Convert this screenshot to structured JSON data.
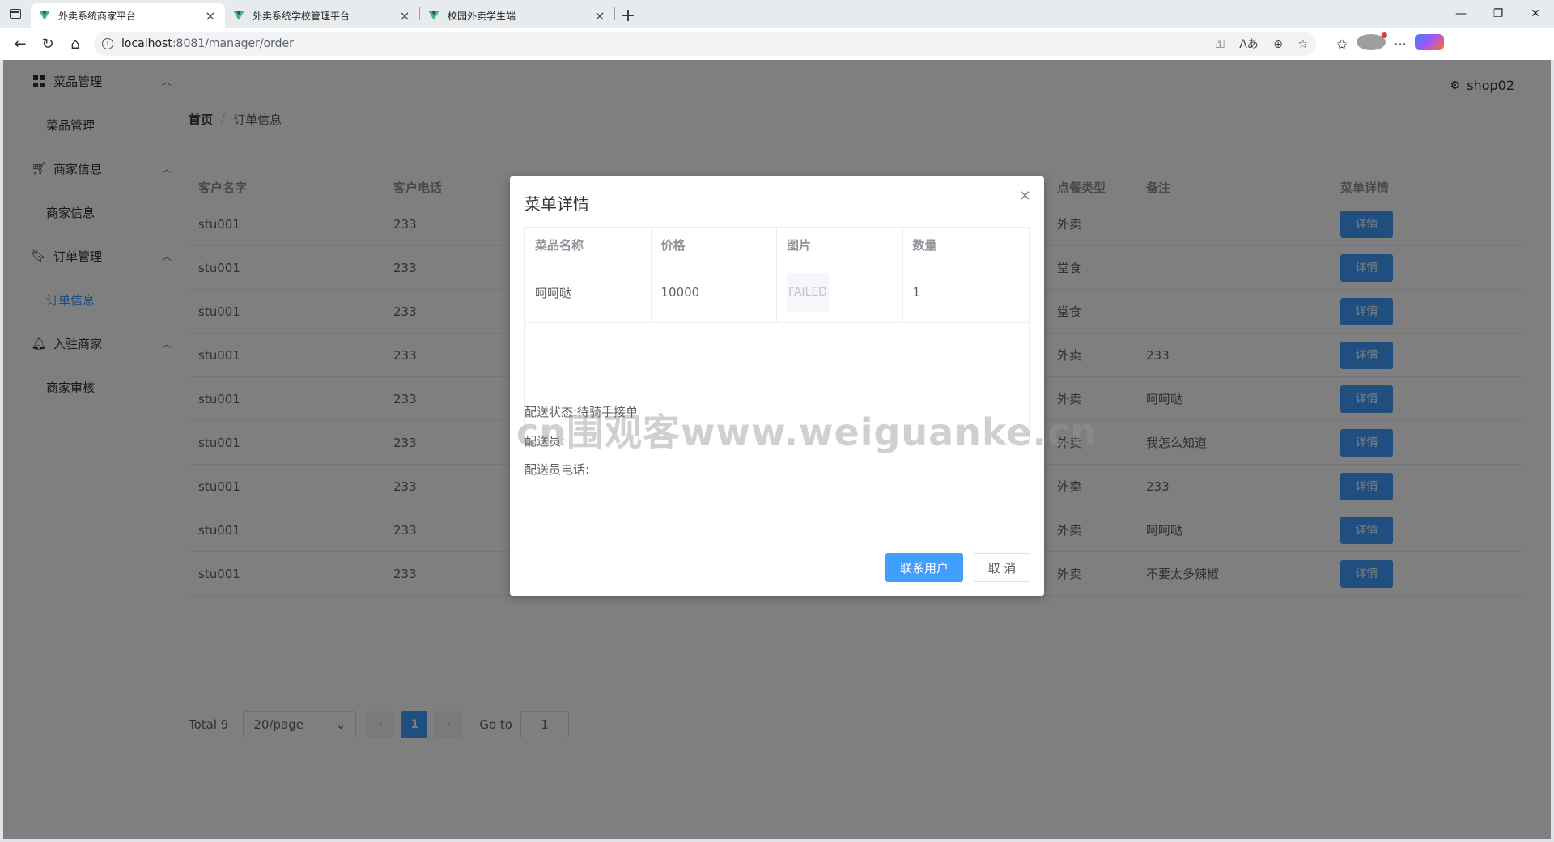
{
  "browser": {
    "tabs": [
      {
        "title": "外卖系统商家平台",
        "active": true
      },
      {
        "title": "外卖系统学校管理平台",
        "active": false
      },
      {
        "title": "校园外卖学生端",
        "active": false
      }
    ],
    "url_host": "localhost",
    "url_rest": ":8081/manager/order"
  },
  "sidebar": {
    "groups": [
      {
        "label": "菜品管理",
        "item": "菜品管理",
        "icon": "grid-icon"
      },
      {
        "label": "商家信息",
        "item": "商家信息",
        "icon": "cart-icon"
      },
      {
        "label": "订单管理",
        "item": "订单信息",
        "icon": "bookmark-icon"
      },
      {
        "label": "入驻商家",
        "item": "商家审核",
        "icon": "bell-icon"
      }
    ]
  },
  "header": {
    "username": "shop02"
  },
  "breadcrumb": {
    "home": "首页",
    "current": "订单信息"
  },
  "orders": {
    "columns": [
      "客户名字",
      "客户电话",
      "点餐类型",
      "备注",
      "菜单详情"
    ],
    "detail_label": "详情",
    "rows": [
      {
        "name": "stu001",
        "phone": "233",
        "type": "外卖",
        "note": ""
      },
      {
        "name": "stu001",
        "phone": "233",
        "type": "堂食",
        "note": ""
      },
      {
        "name": "stu001",
        "phone": "233",
        "type": "堂食",
        "note": ""
      },
      {
        "name": "stu001",
        "phone": "233",
        "type": "外卖",
        "note": "233"
      },
      {
        "name": "stu001",
        "phone": "233",
        "type": "外卖",
        "note": "呵呵哒"
      },
      {
        "name": "stu001",
        "phone": "233",
        "type": "外卖",
        "note": "我怎么知道"
      },
      {
        "name": "stu001",
        "phone": "233",
        "type": "外卖",
        "note": "233"
      },
      {
        "name": "stu001",
        "phone": "233",
        "type": "外卖",
        "note": "呵呵哒"
      },
      {
        "name": "stu001",
        "phone": "233",
        "type": "外卖",
        "note": "不要太多辣椒"
      }
    ]
  },
  "pagination": {
    "total": "Total 9",
    "page_size": "20/page",
    "current": "1",
    "goto_label": "Go to",
    "goto_value": "1"
  },
  "dialog": {
    "title": "菜单详情",
    "columns": [
      "菜品名称",
      "价格",
      "图片",
      "数量"
    ],
    "row": {
      "name": "呵呵哒",
      "price": "10000",
      "image": "FAILED",
      "qty": "1"
    },
    "delivery_status": "配送状态:待骑手接单",
    "courier": "配送员:",
    "courier_phone": "配送员电话:",
    "contact_button": "联系用户",
    "cancel_button": "取 消"
  },
  "watermark": "cn围观客www.weiguanke.cn"
}
